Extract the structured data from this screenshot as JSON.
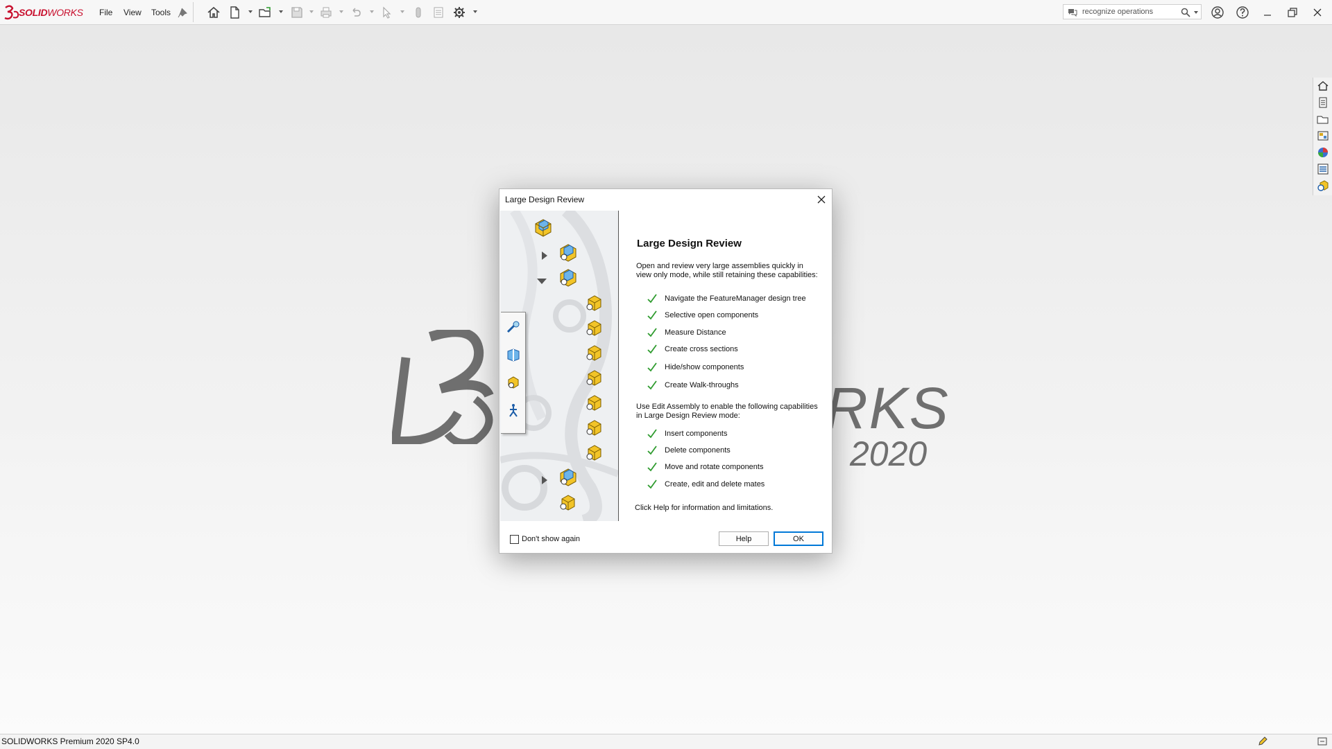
{
  "app": {
    "brand_bold": "SOLID",
    "brand_rest": "WORKS",
    "menu": [
      "File",
      "View",
      "Tools"
    ],
    "search_placeholder": "recognize operations"
  },
  "background": {
    "rks_text": "RKS",
    "year_text": "2020"
  },
  "status_bar": {
    "text": "SOLIDWORKS Premium 2020 SP4.0"
  },
  "dialog": {
    "window_title": "Large Design Review",
    "heading": "Large Design Review",
    "intro": "Open and review very large assemblies quickly in view only mode, while still retaining these capabilities:",
    "capabilities": [
      "Navigate the FeatureManager design tree",
      "Selective open components",
      "Measure Distance",
      "Create cross sections",
      "Hide/show components",
      "Create Walk-throughs"
    ],
    "edit_intro": "Use Edit Assembly to enable the following capabilities in Large Design Review mode:",
    "edit_capabilities": [
      "Insert components",
      "Delete components",
      "Move and rotate components",
      "Create, edit and delete mates"
    ],
    "footer_note": "Click Help for information and limitations.",
    "dont_show_label": "Don't show again",
    "help_label": "Help",
    "ok_label": "OK"
  },
  "colors": {
    "brand_red": "#c8102e",
    "check_green": "#2e9b2e",
    "ok_border": "#0078d7"
  }
}
